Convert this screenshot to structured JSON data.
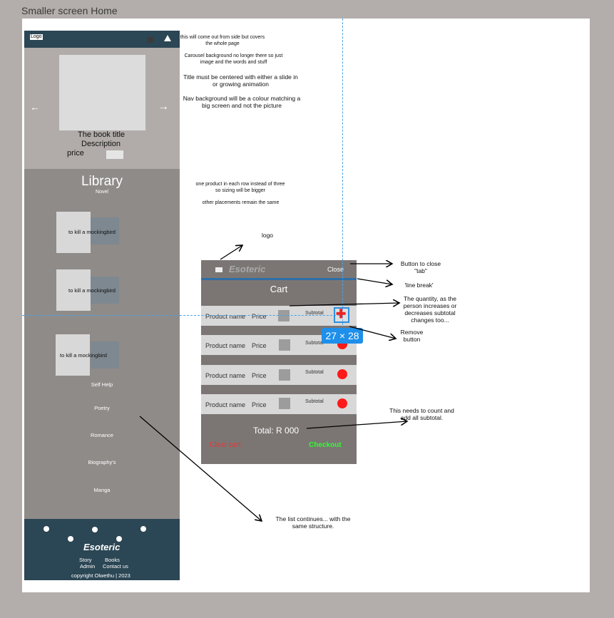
{
  "frame_title": "Smaller screen Home",
  "phone": {
    "logo_label": "Logo",
    "hero": {
      "title": "The book title",
      "description": "Description",
      "price_label": "price"
    },
    "library_title": "Library",
    "library_subtitle": "Novel",
    "books": [
      {
        "title": "to kill a mockingbird"
      },
      {
        "title": "to kill a mockingbird"
      },
      {
        "title": "to kill a mockingbird"
      }
    ],
    "categories": [
      "Self Help",
      "Poetry",
      "Romance",
      "Biography's",
      "Manga"
    ],
    "footer": {
      "brand": "Esoteric",
      "links_row1": [
        "Story",
        "Books"
      ],
      "links_row2": [
        "Admin",
        "Contact us"
      ],
      "copyright": "copyright Olwethu | 2023"
    }
  },
  "notes": {
    "nav_side": "this will come out from side but covers the whole page",
    "carousel_bg": "Carousel background no longer there so just image and the words and stuff",
    "title_centered": "Title must be centered with either a slide in or growing animation",
    "nav_bg": "Nav background will be a colour matching a big screen and not the picture",
    "one_product": "one product in each row instead of three so sizing will be bigger",
    "placements": "other placements remain the same",
    "logo": "logo",
    "close_button": "Button to close \"tab\"",
    "line_break": "'line break'",
    "quantity": "The quantity, as the person increases or decreases subtotal changes too...",
    "remove": "Remove button",
    "count_total": "This needs to count and add all subtotal.",
    "list_continues": "The list continues... with the same structure."
  },
  "cart": {
    "brand": "Esoteric",
    "close_label": "Close",
    "title": "Cart",
    "rows": [
      {
        "name": "Product name",
        "price": "Price",
        "subtotal": "Subtotal"
      },
      {
        "name": "Product name",
        "price": "Price",
        "subtotal": "Subtotal"
      },
      {
        "name": "Product name",
        "price": "Price",
        "subtotal": "Subtotal"
      },
      {
        "name": "Product name",
        "price": "Price",
        "subtotal": "Subtotal"
      }
    ],
    "total": "Total: R 000",
    "clear_label": "Clear cart",
    "checkout_label": "Checkout",
    "colors": {
      "clear": "#ff2b2b",
      "checkout": "#2bff2b",
      "remove": "#ff1a1a",
      "accent": "#2e6ea6"
    }
  },
  "selection_badge": "27 × 28"
}
